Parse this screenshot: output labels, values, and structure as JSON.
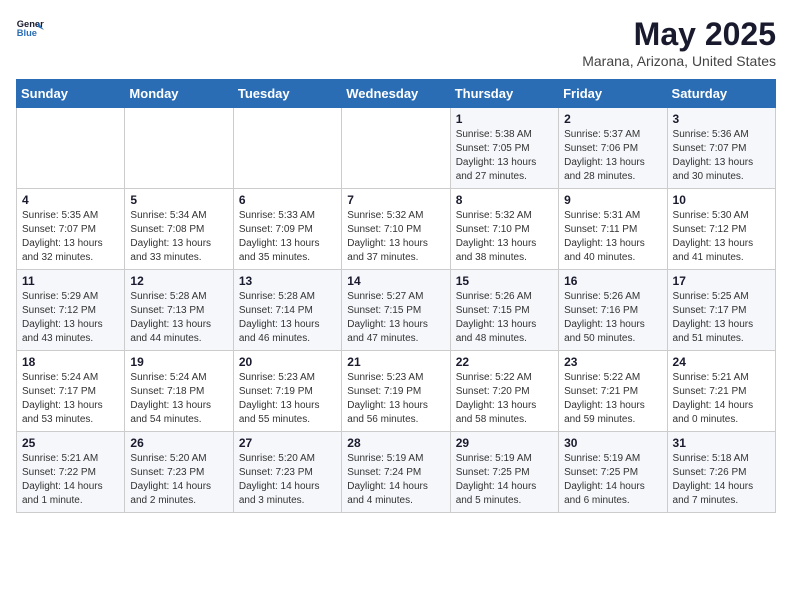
{
  "header": {
    "logo_line1": "General",
    "logo_line2": "Blue",
    "month_title": "May 2025",
    "location": "Marana, Arizona, United States"
  },
  "weekdays": [
    "Sunday",
    "Monday",
    "Tuesday",
    "Wednesday",
    "Thursday",
    "Friday",
    "Saturday"
  ],
  "weeks": [
    [
      {
        "day": "",
        "info": ""
      },
      {
        "day": "",
        "info": ""
      },
      {
        "day": "",
        "info": ""
      },
      {
        "day": "",
        "info": ""
      },
      {
        "day": "1",
        "info": "Sunrise: 5:38 AM\nSunset: 7:05 PM\nDaylight: 13 hours\nand 27 minutes."
      },
      {
        "day": "2",
        "info": "Sunrise: 5:37 AM\nSunset: 7:06 PM\nDaylight: 13 hours\nand 28 minutes."
      },
      {
        "day": "3",
        "info": "Sunrise: 5:36 AM\nSunset: 7:07 PM\nDaylight: 13 hours\nand 30 minutes."
      }
    ],
    [
      {
        "day": "4",
        "info": "Sunrise: 5:35 AM\nSunset: 7:07 PM\nDaylight: 13 hours\nand 32 minutes."
      },
      {
        "day": "5",
        "info": "Sunrise: 5:34 AM\nSunset: 7:08 PM\nDaylight: 13 hours\nand 33 minutes."
      },
      {
        "day": "6",
        "info": "Sunrise: 5:33 AM\nSunset: 7:09 PM\nDaylight: 13 hours\nand 35 minutes."
      },
      {
        "day": "7",
        "info": "Sunrise: 5:32 AM\nSunset: 7:10 PM\nDaylight: 13 hours\nand 37 minutes."
      },
      {
        "day": "8",
        "info": "Sunrise: 5:32 AM\nSunset: 7:10 PM\nDaylight: 13 hours\nand 38 minutes."
      },
      {
        "day": "9",
        "info": "Sunrise: 5:31 AM\nSunset: 7:11 PM\nDaylight: 13 hours\nand 40 minutes."
      },
      {
        "day": "10",
        "info": "Sunrise: 5:30 AM\nSunset: 7:12 PM\nDaylight: 13 hours\nand 41 minutes."
      }
    ],
    [
      {
        "day": "11",
        "info": "Sunrise: 5:29 AM\nSunset: 7:12 PM\nDaylight: 13 hours\nand 43 minutes."
      },
      {
        "day": "12",
        "info": "Sunrise: 5:28 AM\nSunset: 7:13 PM\nDaylight: 13 hours\nand 44 minutes."
      },
      {
        "day": "13",
        "info": "Sunrise: 5:28 AM\nSunset: 7:14 PM\nDaylight: 13 hours\nand 46 minutes."
      },
      {
        "day": "14",
        "info": "Sunrise: 5:27 AM\nSunset: 7:15 PM\nDaylight: 13 hours\nand 47 minutes."
      },
      {
        "day": "15",
        "info": "Sunrise: 5:26 AM\nSunset: 7:15 PM\nDaylight: 13 hours\nand 48 minutes."
      },
      {
        "day": "16",
        "info": "Sunrise: 5:26 AM\nSunset: 7:16 PM\nDaylight: 13 hours\nand 50 minutes."
      },
      {
        "day": "17",
        "info": "Sunrise: 5:25 AM\nSunset: 7:17 PM\nDaylight: 13 hours\nand 51 minutes."
      }
    ],
    [
      {
        "day": "18",
        "info": "Sunrise: 5:24 AM\nSunset: 7:17 PM\nDaylight: 13 hours\nand 53 minutes."
      },
      {
        "day": "19",
        "info": "Sunrise: 5:24 AM\nSunset: 7:18 PM\nDaylight: 13 hours\nand 54 minutes."
      },
      {
        "day": "20",
        "info": "Sunrise: 5:23 AM\nSunset: 7:19 PM\nDaylight: 13 hours\nand 55 minutes."
      },
      {
        "day": "21",
        "info": "Sunrise: 5:23 AM\nSunset: 7:19 PM\nDaylight: 13 hours\nand 56 minutes."
      },
      {
        "day": "22",
        "info": "Sunrise: 5:22 AM\nSunset: 7:20 PM\nDaylight: 13 hours\nand 58 minutes."
      },
      {
        "day": "23",
        "info": "Sunrise: 5:22 AM\nSunset: 7:21 PM\nDaylight: 13 hours\nand 59 minutes."
      },
      {
        "day": "24",
        "info": "Sunrise: 5:21 AM\nSunset: 7:21 PM\nDaylight: 14 hours\nand 0 minutes."
      }
    ],
    [
      {
        "day": "25",
        "info": "Sunrise: 5:21 AM\nSunset: 7:22 PM\nDaylight: 14 hours\nand 1 minute."
      },
      {
        "day": "26",
        "info": "Sunrise: 5:20 AM\nSunset: 7:23 PM\nDaylight: 14 hours\nand 2 minutes."
      },
      {
        "day": "27",
        "info": "Sunrise: 5:20 AM\nSunset: 7:23 PM\nDaylight: 14 hours\nand 3 minutes."
      },
      {
        "day": "28",
        "info": "Sunrise: 5:19 AM\nSunset: 7:24 PM\nDaylight: 14 hours\nand 4 minutes."
      },
      {
        "day": "29",
        "info": "Sunrise: 5:19 AM\nSunset: 7:25 PM\nDaylight: 14 hours\nand 5 minutes."
      },
      {
        "day": "30",
        "info": "Sunrise: 5:19 AM\nSunset: 7:25 PM\nDaylight: 14 hours\nand 6 minutes."
      },
      {
        "day": "31",
        "info": "Sunrise: 5:18 AM\nSunset: 7:26 PM\nDaylight: 14 hours\nand 7 minutes."
      }
    ]
  ]
}
